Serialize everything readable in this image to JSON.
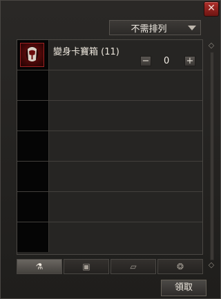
{
  "header": {
    "close_glyph": "✕",
    "sort_label": "不需排列"
  },
  "items": [
    {
      "name": "變身卡寶箱 (11)",
      "quantity": "0",
      "icon": "treasure-chest-icon"
    }
  ],
  "controls": {
    "minus": "−",
    "plus": "+"
  },
  "tabs": [
    {
      "icon": "potion-icon",
      "glyph": "⚗",
      "active": true
    },
    {
      "icon": "armor-icon",
      "glyph": "▣",
      "active": false
    },
    {
      "icon": "scroll-icon",
      "glyph": "▱",
      "active": false
    },
    {
      "icon": "gem-icon",
      "glyph": "❂",
      "active": false
    }
  ],
  "footer": {
    "claim_label": "領取"
  }
}
